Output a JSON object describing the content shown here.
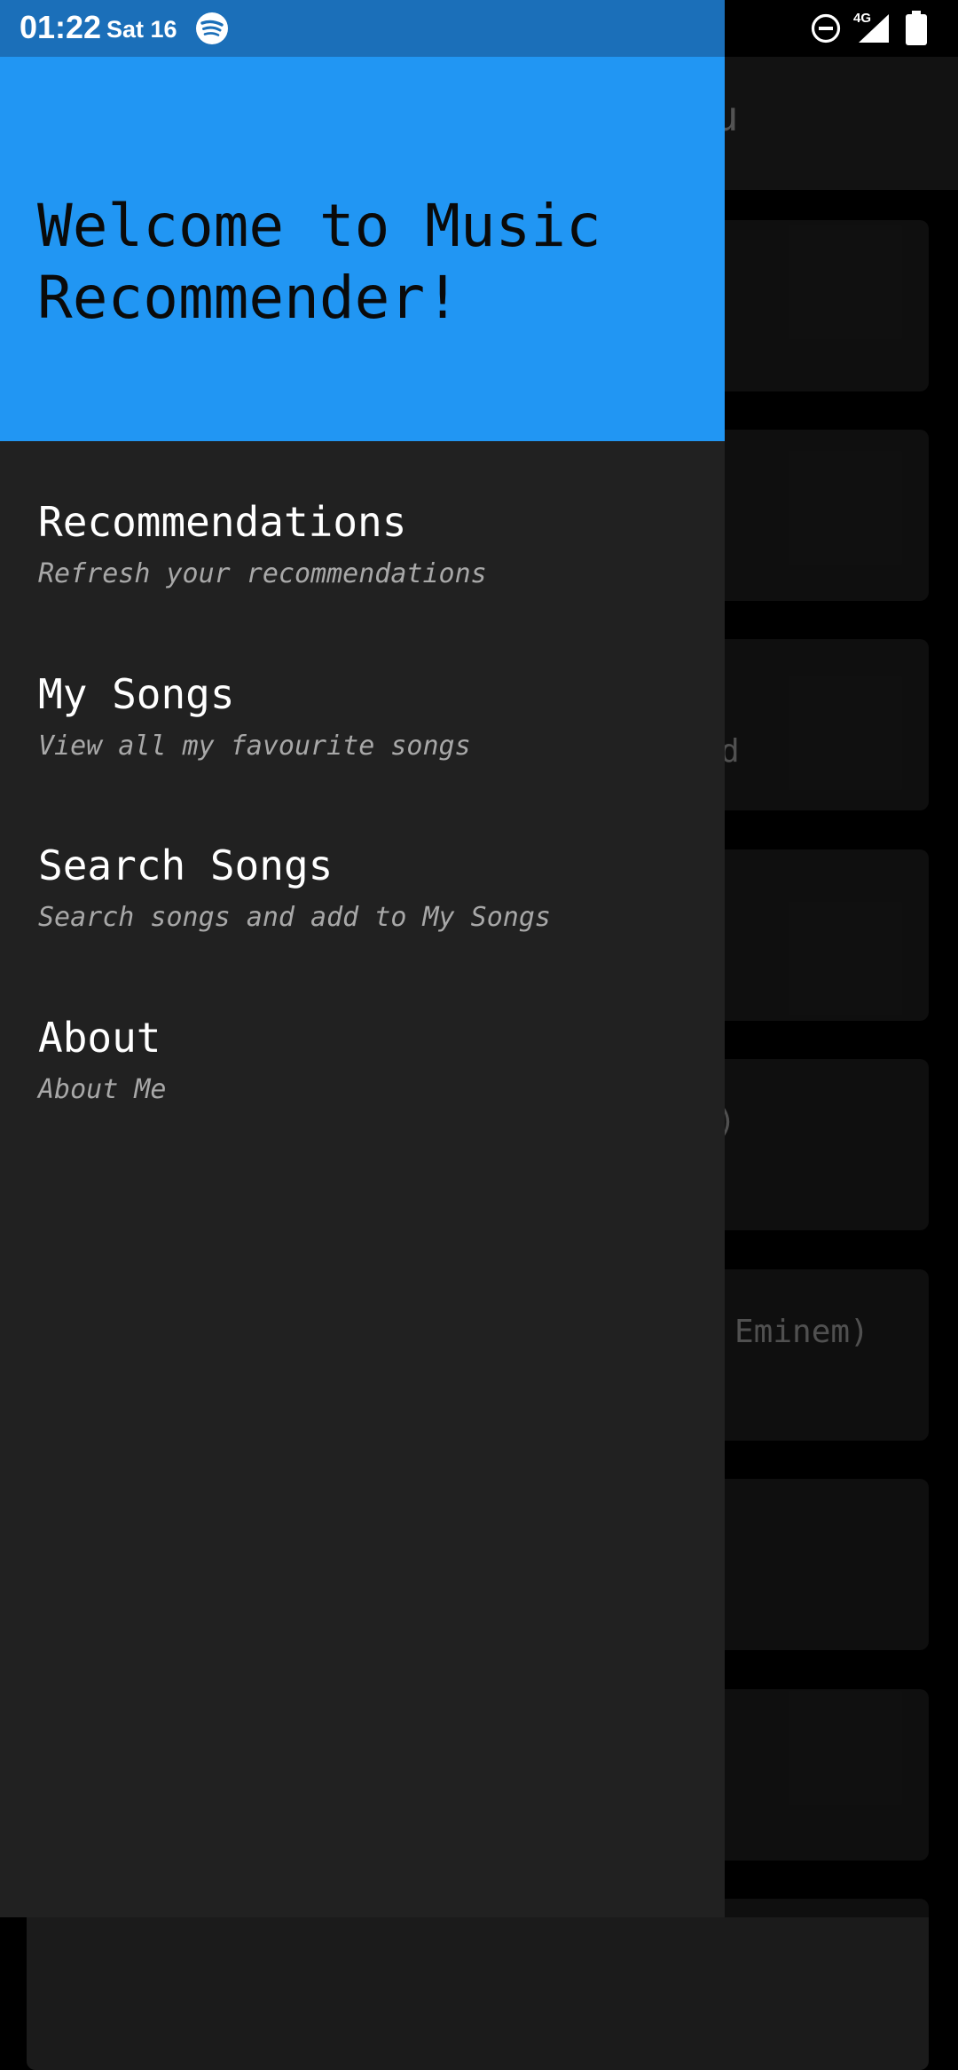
{
  "status_bar": {
    "time": "01:22",
    "date": "Sat 16",
    "network": "4G",
    "icons": [
      "spotify-icon",
      "do-not-disturb-icon",
      "signal-icon",
      "battery-icon"
    ],
    "accent": "#1b6fb9"
  },
  "drawer": {
    "header_title": "Welcome to Music Recommender!",
    "header_color": "#2196f3",
    "background": "#212121",
    "items": [
      {
        "title": "Recommendations",
        "subtitle": "Refresh your recommendations"
      },
      {
        "title": "My Songs",
        "subtitle": "View all my favourite songs"
      },
      {
        "title": "Search Songs",
        "subtitle": "Search songs and add to My Songs"
      },
      {
        "title": "About",
        "subtitle": "About Me"
      }
    ]
  },
  "background_app": {
    "toolbar_title_fragment": "ou",
    "cards": [
      {
        "text": ""
      },
      {
        "text": ""
      },
      {
        "text": "d"
      },
      {
        "text": ""
      },
      {
        "text": ")"
      },
      {
        "text": "Eminem)"
      },
      {
        "text": ""
      },
      {
        "text": ""
      }
    ]
  }
}
